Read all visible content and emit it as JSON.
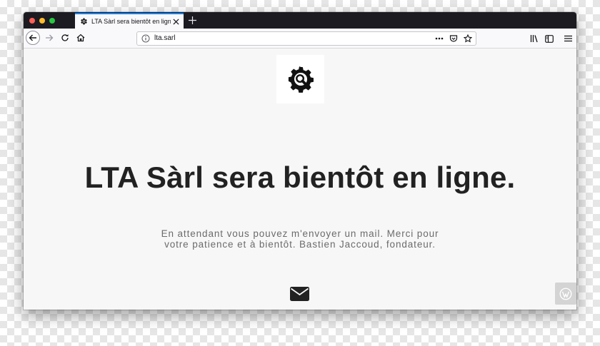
{
  "browser": {
    "tab": {
      "title": "LTA Sàrl sera bientôt en ligne.",
      "favicon": "gear-icon"
    },
    "url": "lta.sarl",
    "accent_color": "#0a84ff",
    "icons": {
      "back": "arrow-left-icon",
      "forward": "arrow-right-icon",
      "reload": "reload-icon",
      "home": "home-icon",
      "page_actions": "more-dots-icon",
      "pocket": "pocket-icon",
      "bookmark": "star-icon",
      "library": "library-icon",
      "sidebar": "sidebar-icon",
      "menu": "hamburger-menu-icon"
    }
  },
  "page": {
    "logo": "gear-search-icon",
    "headline": "LTA Sàrl sera bientôt en ligne.",
    "message": "En attendant vous pouvez m'envoyer un mail. Merci pour votre patience et à bientôt. Bastien Jaccoud, fondateur.",
    "contact_icon": "envelope-icon",
    "badge_icon": "wordpress-icon"
  }
}
